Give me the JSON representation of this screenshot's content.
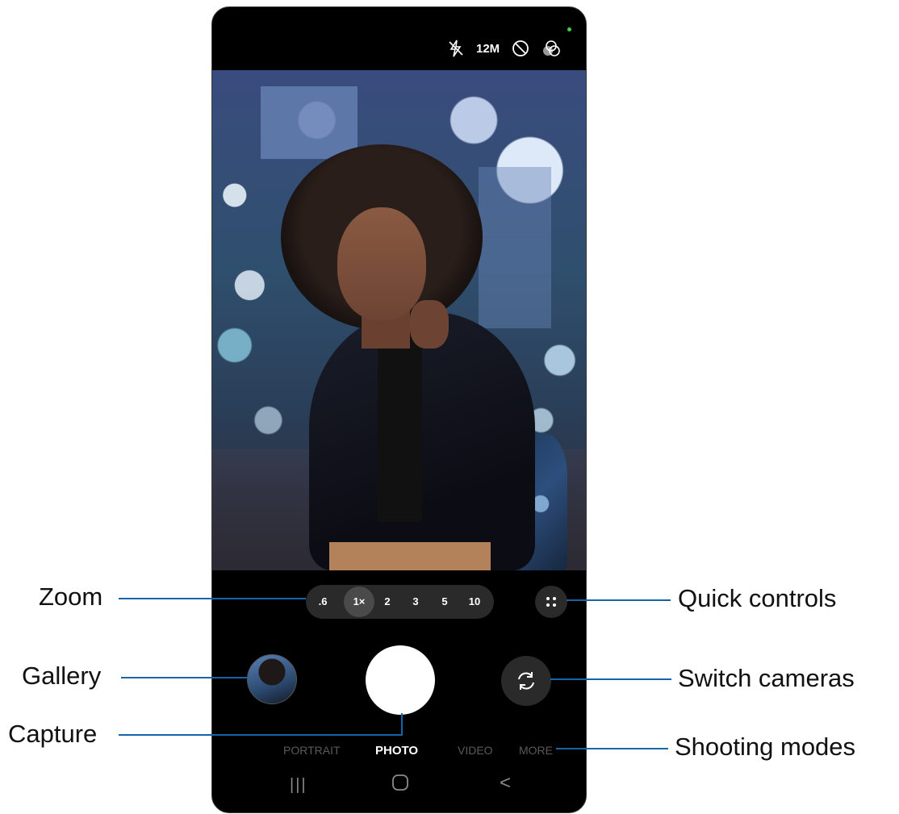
{
  "status_bar": {
    "flash_icon": "flash-off-icon",
    "resolution": "12M",
    "timer_icon": "timer-off-icon",
    "filter_icon": "filters-icon"
  },
  "zoom": {
    "options": [
      ".6",
      "1×",
      "2",
      "3",
      "5",
      "10"
    ],
    "selected": "1×"
  },
  "quick_controls_icon": "four-dots-icon",
  "modes": [
    "PORTRAIT",
    "PHOTO",
    "VIDEO",
    "MORE"
  ],
  "active_mode": "PHOTO",
  "nav_bar": {
    "recent_apps": "|||",
    "home_icon": "home-icon",
    "back": "<"
  },
  "callouts": {
    "zoom": "Zoom",
    "gallery": "Gallery",
    "capture": "Capture",
    "quick_controls": "Quick controls",
    "switch_cameras": "Switch cameras",
    "shooting_modes": "Shooting modes"
  },
  "colors": {
    "callout_line": "#1565a8",
    "status_dot": "#3bd24a"
  }
}
